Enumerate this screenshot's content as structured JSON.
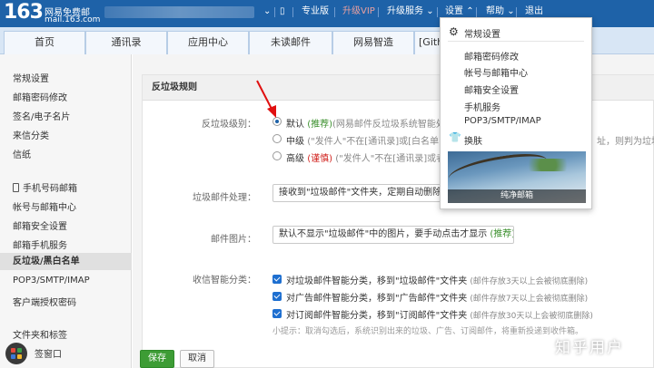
{
  "header": {
    "logo_number": "163",
    "logo_name": "网易免费邮",
    "logo_domain": "mail.163.com",
    "nav": [
      "专业版",
      "升级VIP",
      "升级服务",
      "设置",
      "帮助",
      "退出"
    ]
  },
  "tabs": [
    "首页",
    "通讯录",
    "应用中心",
    "未读邮件",
    "网易智造",
    "[Gith"
  ],
  "sidebar": {
    "items": [
      "常规设置",
      "邮箱密码修改",
      "签名/电子名片",
      "来信分类",
      "信纸",
      "手机号码邮箱",
      "帐号与邮箱中心",
      "邮箱安全设置",
      "邮箱手机服务",
      "反垃圾/黑白名单",
      "POP3/SMTP/IMAP",
      "客户端授权密码",
      "文件夹和标签",
      "签窗口"
    ]
  },
  "content": {
    "section_title": "反垃圾规则",
    "level_label": "反垃圾级别：",
    "levels": [
      {
        "name": "默认",
        "tag": "(推荐)",
        "desc": "(网易邮件反垃圾系统智能处理"
      },
      {
        "name": "中级",
        "tag": "",
        "desc": "(\"发件人\"不在[通讯录]或[白名单]，且",
        "tail": "址，则判为垃圾"
      },
      {
        "name": "高级",
        "tag": "(谨慎)",
        "desc": "(\"发件人\"不在[通讯录]或者[白"
      }
    ],
    "spam_label": "垃圾邮件处理：",
    "spam_value": "接收到\"垃圾邮件\"文件夹，定期自动删除",
    "image_label": "邮件图片：",
    "image_value": "默认不显示\"垃圾邮件\"中的图片，要手动点击才显示",
    "image_tag": "(推荐)",
    "smart_label": "收信智能分类：",
    "smart_options": [
      {
        "text": "对垃圾邮件智能分类，移到\"垃圾邮件\"文件夹",
        "note": "(邮件存放3天以上会被彻底删除)"
      },
      {
        "text": "对广告邮件智能分类，移到\"广告邮件\"文件夹",
        "note": "(邮件存放7天以上会被彻底删除)"
      },
      {
        "text": "对订阅邮件智能分类，移到\"订阅邮件\"文件夹",
        "note": "(邮件存放30天以上会被彻底删除)"
      }
    ],
    "tip": "小提示：取消勾选后，系统识别出来的垃圾、广告、订阅邮件，将重新投递到收件箱。",
    "save": "保存",
    "cancel": "取消"
  },
  "settings_menu": {
    "items": [
      "常规设置",
      "邮箱密码修改",
      "帐号与邮箱中心",
      "邮箱安全设置",
      "手机服务",
      "POP3/SMTP/IMAP",
      "换肤"
    ],
    "theme_caption": "纯净邮箱"
  },
  "watermark": "知乎用户",
  "colors": {
    "header_bg": "#1e62a8",
    "save_btn": "#3d9c35",
    "recommend": "#3a8f2c",
    "caution": "#d0211c"
  }
}
